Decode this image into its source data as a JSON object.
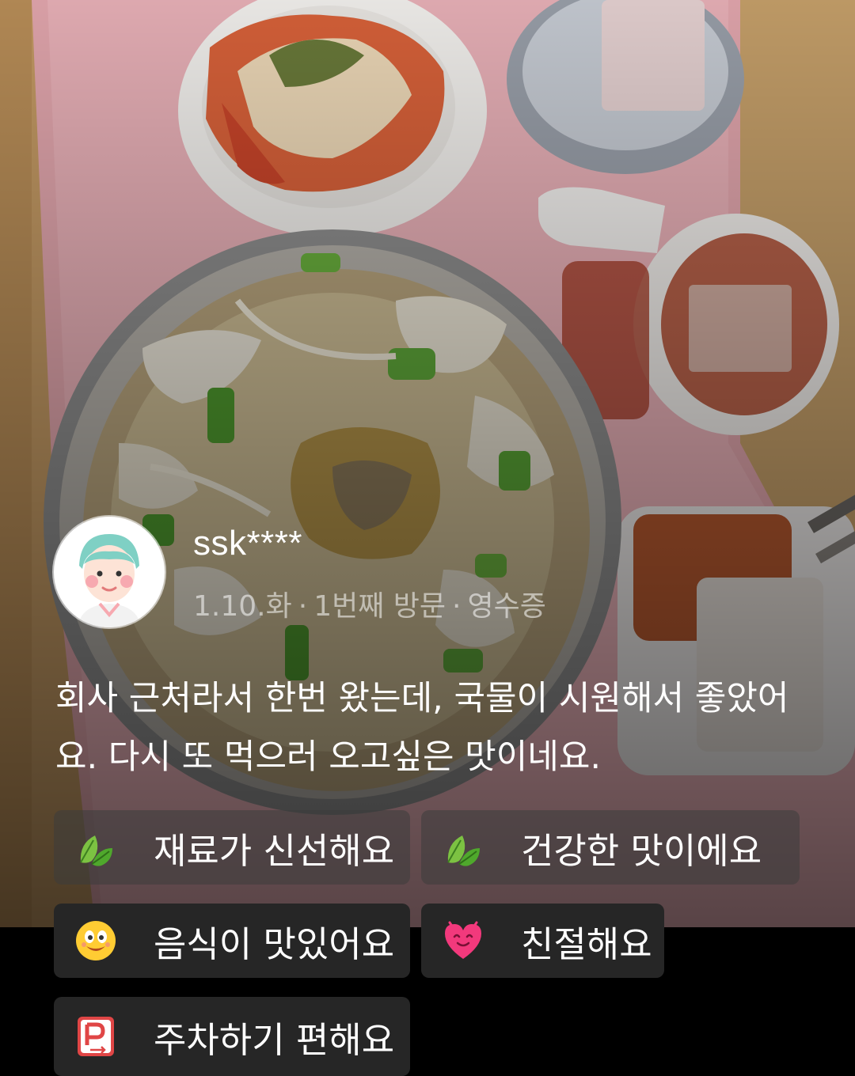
{
  "review": {
    "username": "ssk****",
    "meta": {
      "date": "1.10.화",
      "visit": "1번째 방문",
      "proof": "영수증"
    },
    "text": "회사 근처라서 한번 왔는데, 국물이 시원해서 좋았어요. 다시 또 먹으러 오고싶은 맛이네요.",
    "tags": [
      {
        "icon": "leaf-icon",
        "label": "재료가 신선해요"
      },
      {
        "icon": "leaf-icon",
        "label": "건강한 맛이에요"
      },
      {
        "icon": "smiley-face-icon",
        "label": "음식이 맛있어요"
      },
      {
        "icon": "pink-heart-icon",
        "label": "친절해요"
      },
      {
        "icon": "parking-sign-icon",
        "label": "주차하기 편해요"
      }
    ]
  },
  "colors": {
    "text": "#ffffff",
    "meta_text": "#9a9a9a",
    "tag_bg": "#3c3c3c",
    "tray": "#e8a9b0"
  }
}
